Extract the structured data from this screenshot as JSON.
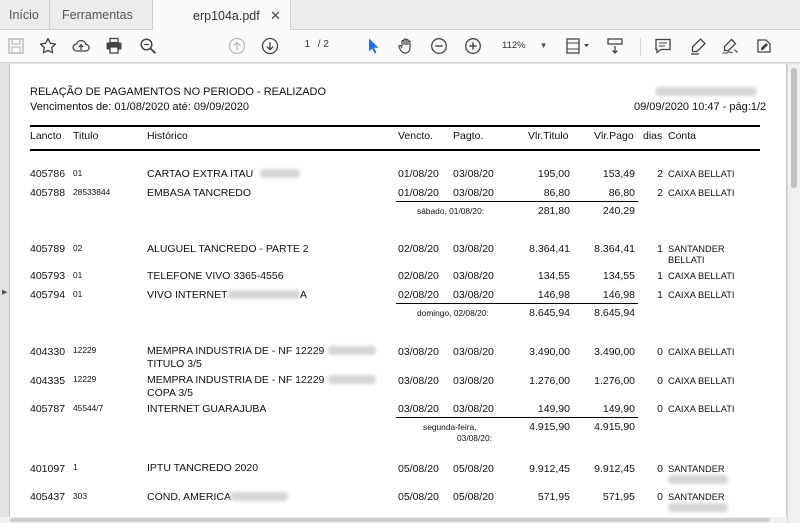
{
  "tabs": {
    "home": "Início",
    "tools": "Ferramentas",
    "document": "erp104a.pdf",
    "close": "✕"
  },
  "toolbar": {
    "page_current": "1",
    "page_total": "/ 2",
    "zoom": "112%"
  },
  "report": {
    "title": "RELAÇÃO DE PAGAMENTOS NO PERIODO - REALIZADO",
    "subtitle": "Vencimentos de: 01/08/2020 até: 09/09/2020",
    "printed": "09/09/2020 10:47 - pág:1/2",
    "columns": [
      "Lancto",
      "Titulo",
      "Histórico",
      "Vencto.",
      "Pagto.",
      "Vlr.Titulo",
      "Vlr.Pago",
      "dias",
      "Conta"
    ],
    "rows": [
      {
        "lancto": "405786",
        "titulo": "01",
        "historico": "CARTAO EXTRA ITAU",
        "vencto": "01/08/20",
        "pagto": "03/08/20",
        "vlr_titulo": "195,00",
        "vlr_pago": "153,49",
        "dias": "2",
        "conta": "CAIXA BELLATI"
      },
      {
        "lancto": "405788",
        "titulo": "28533844",
        "historico": "EMBASA TANCREDO",
        "vencto": "01/08/20",
        "pagto": "03/08/20",
        "vlr_titulo": "86,80",
        "vlr_pago": "86,80",
        "dias": "2",
        "conta": "CAIXA BELLATI"
      },
      {
        "lancto": "405789",
        "titulo": "02",
        "historico": "ALUGUEL TANCREDO - PARTE 2",
        "vencto": "02/08/20",
        "pagto": "03/08/20",
        "vlr_titulo": "8.364,41",
        "vlr_pago": "8.364,41",
        "dias": "1",
        "conta": "SANTANDER",
        "conta2": "BELLATI"
      },
      {
        "lancto": "405793",
        "titulo": "01",
        "historico": "TELEFONE VIVO 3365-4556",
        "vencto": "02/08/20",
        "pagto": "03/08/20",
        "vlr_titulo": "134,55",
        "vlr_pago": "134,55",
        "dias": "1",
        "conta": "CAIXA BELLATI"
      },
      {
        "lancto": "405794",
        "titulo": "01",
        "historico": "VIVO INTERNET",
        "historico_tail": "A",
        "vencto": "02/08/20",
        "pagto": "03/08/20",
        "vlr_titulo": "146,98",
        "vlr_pago": "146,98",
        "dias": "1",
        "conta": "CAIXA BELLATI"
      },
      {
        "lancto": "404330",
        "titulo": "12229",
        "historico": "MEMPRA INDUSTRIA DE  - NF 12229",
        "historico2": "TITULO 3/5",
        "vencto": "03/08/20",
        "pagto": "03/08/20",
        "vlr_titulo": "3.490,00",
        "vlr_pago": "3.490,00",
        "dias": "0",
        "conta": "CAIXA BELLATI"
      },
      {
        "lancto": "404335",
        "titulo": "12229",
        "historico": "MEMPRA INDUSTRIA DE  - NF 12229",
        "historico2": "COPA 3/5",
        "vencto": "03/08/20",
        "pagto": "03/08/20",
        "vlr_titulo": "1.276,00",
        "vlr_pago": "1.276,00",
        "dias": "0",
        "conta": "CAIXA BELLATI"
      },
      {
        "lancto": "405787",
        "titulo": "45544/7",
        "historico": "INTERNET GUARAJUBA",
        "vencto": "03/08/20",
        "pagto": "03/08/20",
        "vlr_titulo": "149,90",
        "vlr_pago": "149,90",
        "dias": "0",
        "conta": "CAIXA BELLATI"
      },
      {
        "lancto": "401097",
        "titulo": "1",
        "historico": "IPTU TANCREDO 2020",
        "vencto": "05/08/20",
        "pagto": "05/08/20",
        "vlr_titulo": "9.912,45",
        "vlr_pago": "9.912,45",
        "dias": "0",
        "conta": "SANTANDER"
      },
      {
        "lancto": "405437",
        "titulo": "303",
        "historico": "COND. AMERICA",
        "vencto": "05/08/20",
        "pagto": "05/08/20",
        "vlr_titulo": "571,95",
        "vlr_pago": "571,95",
        "dias": "0",
        "conta": "SANTANDER"
      }
    ],
    "subtotals": [
      {
        "label": "sábado, 01/08/20:",
        "titulo": "281,80",
        "pago": "240,29"
      },
      {
        "label": "domingo, 02/08/20:",
        "titulo": "8.645,94",
        "pago": "8.645,94"
      },
      {
        "label": "segunda-feira,",
        "label2": "03/08/20:",
        "titulo": "4.915,90",
        "pago": "4.915,90"
      }
    ]
  }
}
